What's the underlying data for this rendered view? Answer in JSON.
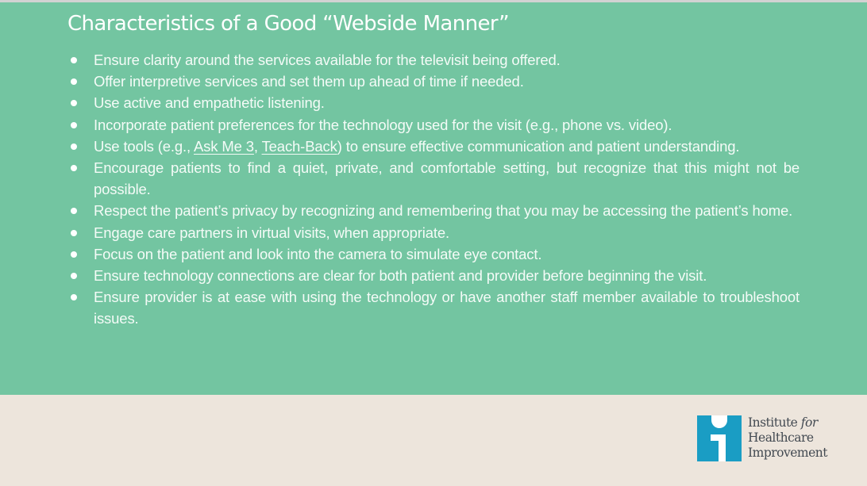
{
  "slide": {
    "title": "Characteristics of a Good “Webside Manner”",
    "bullets": [
      {
        "text": "Ensure clarity around the services available for the televisit being offered."
      },
      {
        "text": "Offer interpretive services and set them up ahead of time if needed."
      },
      {
        "text": "Use active and empathetic listening."
      },
      {
        "text": "Incorporate patient preferences for the technology used for the visit (e.g., phone vs. video)."
      },
      {
        "prefix": "Use tools (e.g., ",
        "link1": "Ask Me 3",
        "separator": ", ",
        "link2": "Teach-Back",
        "suffix": ") to ensure effective communication and patient understanding."
      },
      {
        "text": "Encourage patients to find a quiet, private, and comfortable setting, but recognize that this might not be possible."
      },
      {
        "text": "Respect the patient’s privacy by recognizing and remembering that you may be accessing the patient’s home."
      },
      {
        "text": "Engage care partners in virtual visits, when appropriate."
      },
      {
        "text": "Focus on the patient and look into the camera to simulate eye contact."
      },
      {
        "text": "Ensure technology connections are clear for both patient and provider before beginning the visit."
      },
      {
        "text": "Ensure provider is at ease with using the technology or have another staff member available to troubleshoot issues."
      }
    ]
  },
  "logo": {
    "line1": "Institute",
    "line1_italic": "for",
    "line2": "Healthcare",
    "line3": "Improvement",
    "icon": "ihi-i-icon"
  },
  "colors": {
    "panel": "#73c5a1",
    "background": "#ede5dc",
    "logo_blue": "#1a9dc4",
    "logo_text": "#434a52"
  }
}
